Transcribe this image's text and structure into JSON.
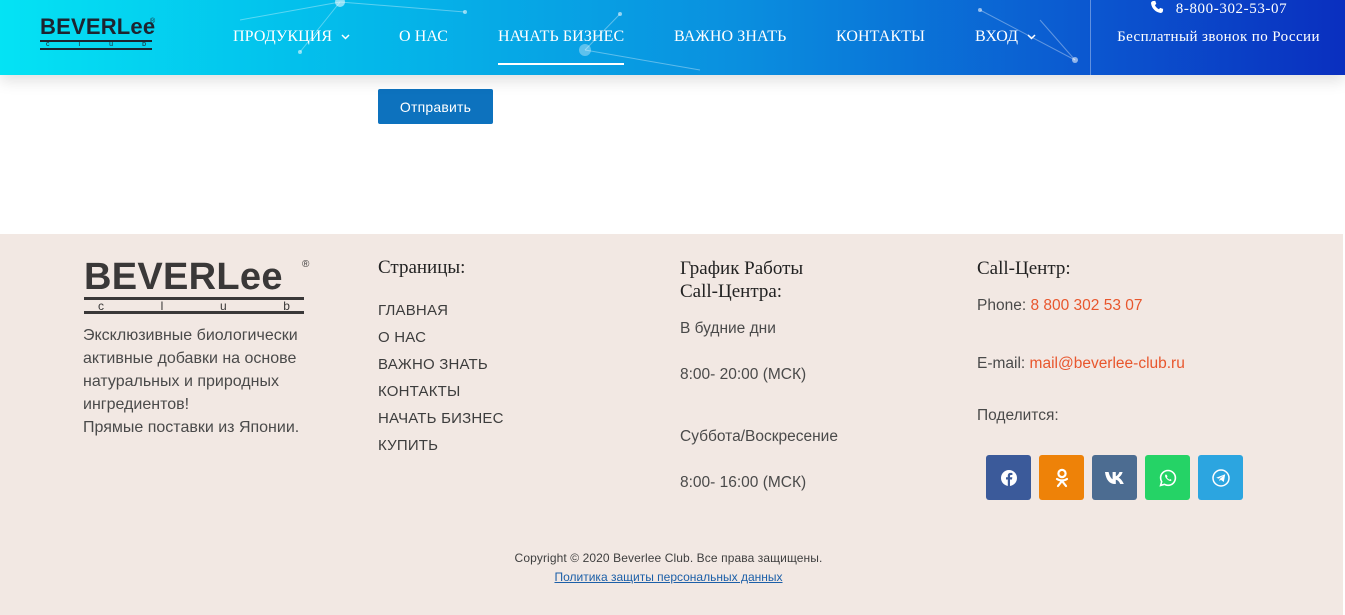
{
  "header": {
    "logo_word": "BEVERLee",
    "logo_sub": [
      "c",
      "l",
      "u",
      "b"
    ],
    "nav": [
      {
        "label": "ПРОДУКЦИЯ",
        "has_dropdown": true,
        "active": false
      },
      {
        "label": "О НАС",
        "has_dropdown": false,
        "active": false
      },
      {
        "label": "НАЧАТЬ БИЗНЕС",
        "has_dropdown": false,
        "active": true
      },
      {
        "label": "ВАЖНО ЗНАТЬ",
        "has_dropdown": false,
        "active": false
      },
      {
        "label": "КОНТАКТЫ",
        "has_dropdown": false,
        "active": false
      },
      {
        "label": "ВХОД",
        "has_dropdown": true,
        "active": false
      }
    ],
    "phone": "8-800-302-53-07",
    "phone_caption": "Бесплатный звонок по России",
    "phone_icon": "phone-icon"
  },
  "form": {
    "submit_label": "Отправить"
  },
  "footer": {
    "logo_word": "BEVERLee",
    "logo_sub": [
      "c",
      "l",
      "u",
      "b"
    ],
    "description": "Эксклюзивные биологически активные добавки на основе натуральных и природных ингредиентов!",
    "description_2": "Прямые поставки из Японии.",
    "pages_heading": "Страницы:",
    "pages": [
      "ГЛАВНАЯ",
      "О НАС",
      "ВАЖНО ЗНАТЬ",
      "КОНТАКТЫ",
      "НАЧАТЬ БИЗНЕС",
      "КУПИТЬ"
    ],
    "schedule_heading_1": "График Работы",
    "schedule_heading_2": "Call-Центра:",
    "weekdays_label": "В будние дни",
    "weekdays_hours": "8:00- 20:00 (МСК)",
    "weekend_label": "Суббота/Воскресение",
    "weekend_hours": "8:00- 16:00 (МСК)",
    "callcenter_heading": "Call-Центр:",
    "phone_label": "Phone: ",
    "phone_value": "8 800 302 53 07",
    "email_label": "E-mail: ",
    "email_value": "mail@beverlee-club.ru",
    "share_label": "Поделится:",
    "share_buttons": [
      {
        "name": "facebook-icon",
        "color": "#3b5a9a"
      },
      {
        "name": "odnoklassniki-icon",
        "color": "#ee8208"
      },
      {
        "name": "vk-icon",
        "color": "#4c6c91"
      },
      {
        "name": "whatsapp-icon",
        "color": "#25d366"
      },
      {
        "name": "telegram-icon",
        "color": "#2ca5e0"
      }
    ],
    "copyright": "Copyright © 2020 Beverlee Club. Все права защищены.",
    "policy": "Политика защиты персональных данных"
  },
  "colors": {
    "accent": "#e8562d",
    "button": "#0d72be",
    "footer_bg": "#f2e8e3"
  }
}
